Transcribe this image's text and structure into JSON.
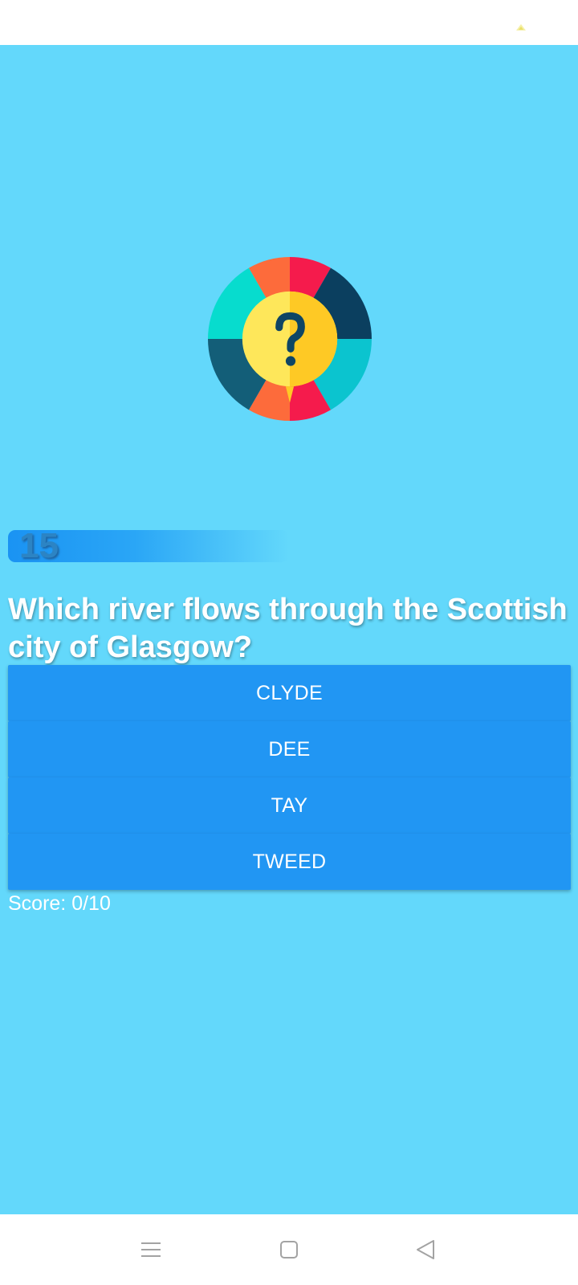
{
  "colors": {
    "background": "#63d8fb",
    "answer_button": "#2196f3",
    "timer_bar": "#1a93f3",
    "text": "#ffffff"
  },
  "status_bar": {
    "icon": "battery-saver-icon"
  },
  "logo": {
    "icon": "question-wheel-icon"
  },
  "timer": {
    "value": "15"
  },
  "question": {
    "text": "Which river flows through the Scottish city of Glasgow?"
  },
  "answers": [
    "CLYDE",
    "DEE",
    "TAY",
    "TWEED"
  ],
  "score": {
    "text": "Score: 0/10"
  },
  "nav_bar": {
    "icons": [
      "menu-icon",
      "home-icon",
      "back-icon"
    ]
  }
}
